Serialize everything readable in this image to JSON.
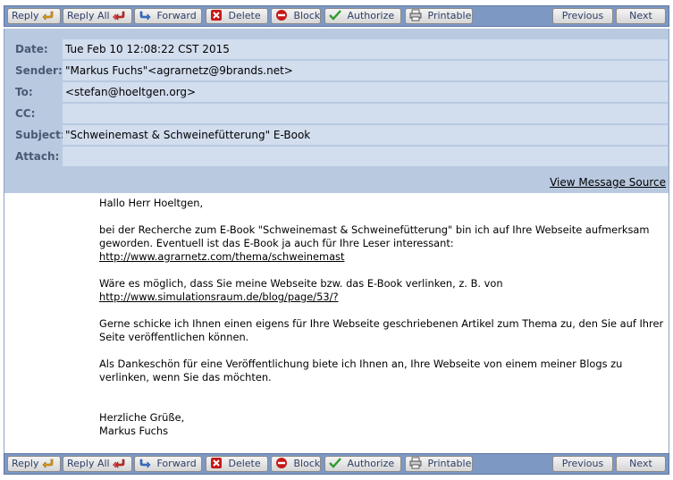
{
  "toolbar": {
    "reply": "Reply",
    "reply_all": "Reply All",
    "forward": "Forward",
    "delete": "Delete",
    "block": "Block",
    "authorize": "Authorize",
    "printable": "Printable",
    "previous": "Previous",
    "next": "Next"
  },
  "headers": {
    "date_label": "Date:",
    "date": "Tue Feb 10 12:08:22 CST 2015",
    "sender_label": "Sender:",
    "sender": "\"Markus Fuchs\"<agrarnetz@9brands.net>",
    "to_label": "To:",
    "to": "<stefan@hoeltgen.org>",
    "cc_label": "CC:",
    "cc": "",
    "subject_label": "Subject:",
    "subject": "\"Schweinemast & Schweinefütterung\" E-Book",
    "attach_label": "Attach:",
    "attach": ""
  },
  "view_source": "View Message Source",
  "message": {
    "greeting": "Hallo Herr Hoeltgen,",
    "p1_text": "bei der Recherche zum E-Book \"Schweinemast & Schweinefütterung\" bin ich auf Ihre Webseite aufmerksam geworden. Eventuell ist das E-Book ja auch für Ihre Leser interessant:",
    "p1_link": "http://www.agrarnetz.com/thema/schweinemast",
    "p2_text": "Wäre es möglich, dass Sie meine Webseite bzw. das E-Book verlinken, z. B. von ",
    "p2_link": "http://www.simulationsraum.de/blog/page/53/?",
    "p3": "Gerne schicke ich Ihnen einen eigens für Ihre Webseite geschriebenen Artikel zum Thema zu, den Sie auf Ihrer Seite veröffentlichen können.",
    "p4": "Als Dankeschön für eine Veröffentlichung biete ich Ihnen an, Ihre Webseite von einem meiner Blogs zu verlinken, wenn Sie das möchten.",
    "closing": "Herzliche Grüße,",
    "signature": "Markus Fuchs"
  },
  "icons": {
    "reply": "reply-arrow-icon",
    "reply_all": "reply-all-arrow-icon",
    "forward": "forward-arrow-icon",
    "delete": "delete-x-icon",
    "block": "block-icon",
    "authorize": "checkmark-icon",
    "printable": "printer-icon"
  },
  "colors": {
    "toolbar": "#7e98c4",
    "header_bg": "#b9c9e0",
    "field_bg": "#d2ddee",
    "label_text": "#4a5a72",
    "button_text": "#2e3f66"
  }
}
